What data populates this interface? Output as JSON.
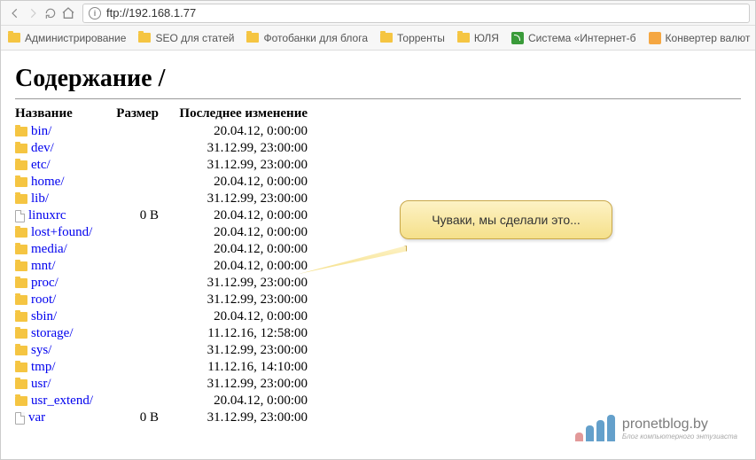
{
  "toolbar": {
    "url": "ftp://192.168.1.77"
  },
  "bookmarks": [
    {
      "icon": "folder",
      "label": "Администрирование"
    },
    {
      "icon": "folder",
      "label": "SEO для статей"
    },
    {
      "icon": "folder",
      "label": "Фотобанки для блога"
    },
    {
      "icon": "folder",
      "label": "Торренты"
    },
    {
      "icon": "folder",
      "label": "ЮЛЯ"
    },
    {
      "icon": "rss",
      "label": "Система «Интернет-б"
    },
    {
      "icon": "conv",
      "label": "Конвертер валют"
    }
  ],
  "page_title": "Содержание /",
  "columns": {
    "name": "Название",
    "size": "Размер",
    "modified": "Последнее изменение"
  },
  "rows": [
    {
      "type": "folder",
      "name": "bin/",
      "size": "",
      "date": "20.04.12, 0:00:00"
    },
    {
      "type": "folder",
      "name": "dev/",
      "size": "",
      "date": "31.12.99, 23:00:00"
    },
    {
      "type": "folder",
      "name": "etc/",
      "size": "",
      "date": "31.12.99, 23:00:00"
    },
    {
      "type": "folder",
      "name": "home/",
      "size": "",
      "date": "20.04.12, 0:00:00"
    },
    {
      "type": "folder",
      "name": "lib/",
      "size": "",
      "date": "31.12.99, 23:00:00"
    },
    {
      "type": "file",
      "name": "linuxrc",
      "size": "0 B",
      "date": "20.04.12, 0:00:00"
    },
    {
      "type": "folder",
      "name": "lost+found/",
      "size": "",
      "date": "20.04.12, 0:00:00"
    },
    {
      "type": "folder",
      "name": "media/",
      "size": "",
      "date": "20.04.12, 0:00:00"
    },
    {
      "type": "folder",
      "name": "mnt/",
      "size": "",
      "date": "20.04.12, 0:00:00"
    },
    {
      "type": "folder",
      "name": "proc/",
      "size": "",
      "date": "31.12.99, 23:00:00"
    },
    {
      "type": "folder",
      "name": "root/",
      "size": "",
      "date": "31.12.99, 23:00:00"
    },
    {
      "type": "folder",
      "name": "sbin/",
      "size": "",
      "date": "20.04.12, 0:00:00"
    },
    {
      "type": "folder",
      "name": "storage/",
      "size": "",
      "date": "11.12.16, 12:58:00"
    },
    {
      "type": "folder",
      "name": "sys/",
      "size": "",
      "date": "31.12.99, 23:00:00"
    },
    {
      "type": "folder",
      "name": "tmp/",
      "size": "",
      "date": "11.12.16, 14:10:00"
    },
    {
      "type": "folder",
      "name": "usr/",
      "size": "",
      "date": "31.12.99, 23:00:00"
    },
    {
      "type": "folder",
      "name": "usr_extend/",
      "size": "",
      "date": "20.04.12, 0:00:00"
    },
    {
      "type": "file",
      "name": "var",
      "size": "0 B",
      "date": "31.12.99, 23:00:00"
    }
  ],
  "callout_text": "Чуваки, мы сделали это...",
  "watermark": {
    "line1": "pronetblog.by",
    "line2": "Блог компьютерного энтузиаста"
  }
}
